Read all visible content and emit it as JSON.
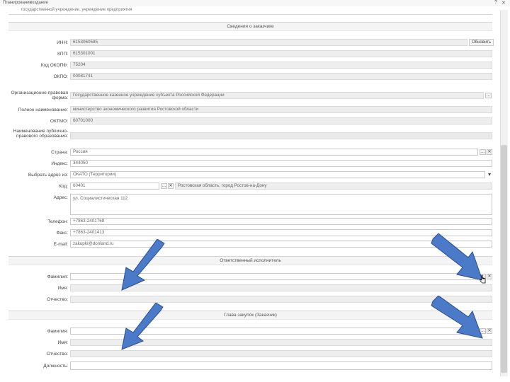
{
  "window": {
    "menu_left": "Планирование",
    "menu_right": "создание",
    "question": "?",
    "close": "✕"
  },
  "top_cut_text": "государственной учреждение, учреждение предприятия",
  "sections": {
    "customer": "Сведения о заказчике",
    "executor": "Ответственный исполнитель",
    "head": "Глава закупок (Заказчик)"
  },
  "customer": {
    "inn": {
      "label": "ИНН:",
      "value": "6153060585"
    },
    "check_button": "Обновить",
    "kpp": {
      "label": "КПП:",
      "value": "615301001"
    },
    "okopf": {
      "label": "Код ОКОПФ:",
      "value": "75204"
    },
    "okpo": {
      "label": "ОКПО:",
      "value": "00081741"
    },
    "org_form": {
      "label": "Организационно-правовая форма:",
      "value": "Государственное казенное учреждение субъекта Российской Федерации"
    },
    "full_name": {
      "label": "Полное наименование:",
      "value": "министерство экономического развития Ростовской области"
    },
    "oktmo": {
      "label": "ОКТМО:",
      "value": "60701000"
    },
    "ppo": {
      "label": "Наименование публично-правового образования:",
      "value": ""
    },
    "country": {
      "label": "Страна:",
      "value": "Россия"
    },
    "index": {
      "label": "Индекс:",
      "value": "344050"
    },
    "address_choice": {
      "label": "Выбрать адрес из:",
      "value": "ОКАТО (Территории)"
    },
    "code": {
      "label": "Код:",
      "value": "60401",
      "region": "Ростовская область, город Ростов-на-Дону"
    },
    "address": {
      "label": "Адрес:",
      "value": "ул. Социалистическая 112"
    },
    "phone": {
      "label": "Телефон:",
      "value": "+7863-2401768"
    },
    "fax": {
      "label": "Факс:",
      "value": "+7863-2401413"
    },
    "email": {
      "label": "E-mail:",
      "value": "zakupki@donland.ru"
    }
  },
  "executor": {
    "surname": {
      "label": "Фамилия:",
      "value": ""
    },
    "name": {
      "label": "Имя:",
      "value": ""
    },
    "patronymic": {
      "label": "Отчество:",
      "value": ""
    }
  },
  "head": {
    "surname": {
      "label": "Фамилия:",
      "value": ""
    },
    "name": {
      "label": "Имя:",
      "value": ""
    },
    "patronymic": {
      "label": "Отчество:",
      "value": ""
    },
    "position": {
      "label": "Должность:",
      "value": ""
    }
  },
  "buttons": {
    "ellipsis": "...",
    "clear": "✕",
    "dropdown": "▾"
  },
  "colors": {
    "arrow_fill": "#4a7ac8",
    "arrow_stroke": "#2a4f8f"
  }
}
